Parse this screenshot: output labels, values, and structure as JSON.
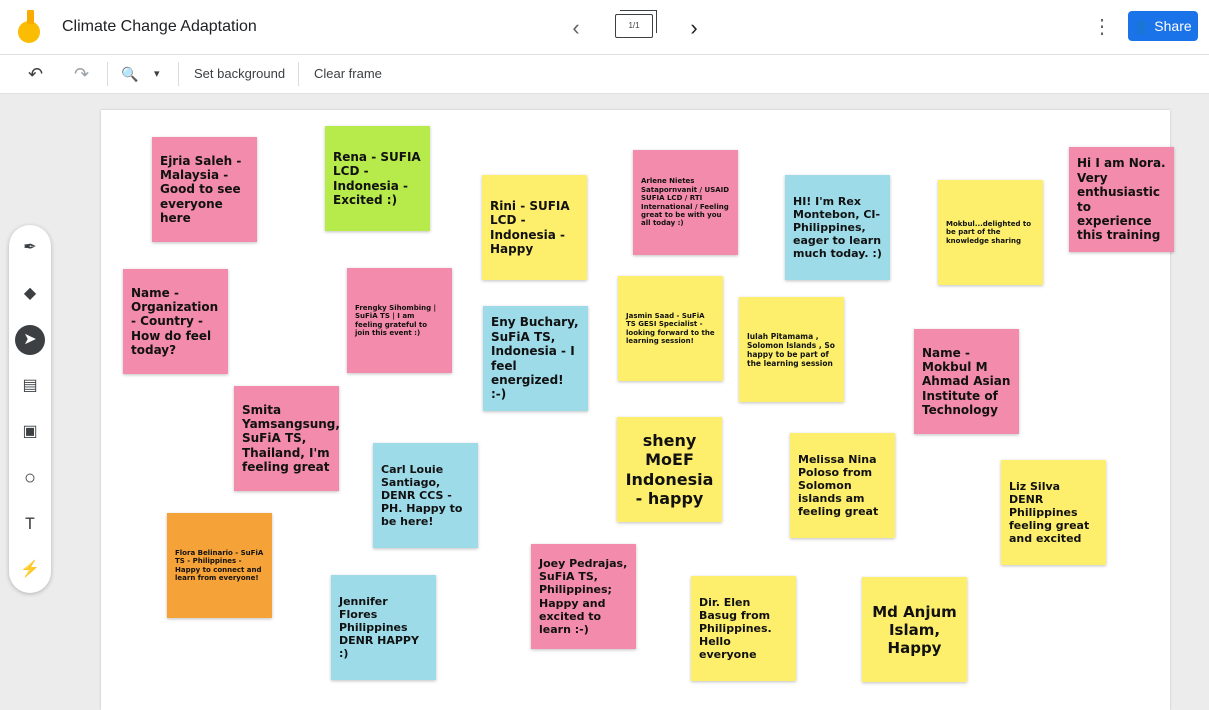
{
  "header": {
    "title": "Climate Change Adaptation",
    "frame_indicator": "1/1",
    "prev_glyph": "‹",
    "next_glyph": "›",
    "more_glyph": "⋮",
    "share_label": "Share",
    "share_icon": "👤"
  },
  "toolbar": {
    "undo_glyph": "↶",
    "redo_glyph": "↷",
    "zoom_glyph": "🔍",
    "zoom_dropdown_glyph": "▾",
    "set_background_label": "Set background",
    "clear_frame_label": "Clear frame"
  },
  "tools": [
    {
      "name": "pen",
      "glyph": "✒"
    },
    {
      "name": "eraser",
      "glyph": "◆"
    },
    {
      "name": "select",
      "glyph": "➤"
    },
    {
      "name": "sticky-note",
      "glyph": "▤"
    },
    {
      "name": "image",
      "glyph": "▣"
    },
    {
      "name": "circle",
      "glyph": "○"
    },
    {
      "name": "text-box",
      "glyph": "T"
    },
    {
      "name": "laser",
      "glyph": "⚡"
    }
  ],
  "notes": [
    {
      "text": "Ejria Saleh - Malaysia - Good to see everyone here",
      "color": "#f28bac"
    },
    {
      "text": "Rena - SUFIA LCD - Indonesia - Excited :)",
      "color": "#b7ea4b"
    },
    {
      "text": "Rini - SUFIA LCD - Indonesia - Happy",
      "color": "#fdef6c"
    },
    {
      "text": "Arlene Nietes Satapornvanit / USAID SUFIA LCD / RTI International / Feeling great to be with you all today :)",
      "color": "#f28bac"
    },
    {
      "text": "HI! I'm Rex Montebon, CI-Philippines, eager to learn much today. :)",
      "color": "#9ddbe9"
    },
    {
      "text": "Mokbul...delighted to be part of the knowledge sharing",
      "color": "#fdef6c"
    },
    {
      "text": "Hi I am Nora. Very enthusiastic to experience this training",
      "color": "#f28bac"
    },
    {
      "text": "Name - Organization - Country - How do feel today?",
      "color": "#f28bac"
    },
    {
      "text": "Frengky Sihombing | SuFiA TS | I am feeling grateful to join this event :)",
      "color": "#f28bac"
    },
    {
      "text": "Eny Buchary, SuFiA TS, Indonesia - I feel energized! :-)",
      "color": "#9ddbe9"
    },
    {
      "text": "Jasmin Saad - SuFiA TS GESI Specialist - looking forward to the learning session!",
      "color": "#fdef6c"
    },
    {
      "text": "Iulah Pitamama , Solomon Islands , So happy to be part of the learning session",
      "color": "#fdef6c"
    },
    {
      "text": "Name -Mokbul M Ahmad Asian Institute of Technology",
      "color": "#f28bac"
    },
    {
      "text": "Smita Yamsangsung, SuFiA TS, Thailand, I'm feeling great",
      "color": "#f28bac"
    },
    {
      "text": "Carl Louie Santiago, DENR CCS - PH. Happy to be here!",
      "color": "#9ddbe9"
    },
    {
      "text": "sheny MoEF Indonesia - happy",
      "color": "#fdef6c"
    },
    {
      "text": "Melissa Nina Poloso from Solomon islands am feeling great",
      "color": "#fdef6c"
    },
    {
      "text": "Liz Silva DENR Philippines feeling great and excited",
      "color": "#fdef6c"
    },
    {
      "text": "Flora Belinario - SuFiA TS - Philippines - Happy to connect and learn from everyone!",
      "color": "#f5a238"
    },
    {
      "text": "Jennifer Flores Philippines DENR HAPPY :)",
      "color": "#9ddbe9"
    },
    {
      "text": "Joey Pedrajas, SuFiA TS, Philippines; Happy and excited to learn :-)",
      "color": "#f28bac"
    },
    {
      "text": "Dir. Elen Basug from Philippines. Hello everyone",
      "color": "#fdef6c"
    },
    {
      "text": "Md Anjum Islam, Happy",
      "color": "#fdef6c"
    }
  ]
}
